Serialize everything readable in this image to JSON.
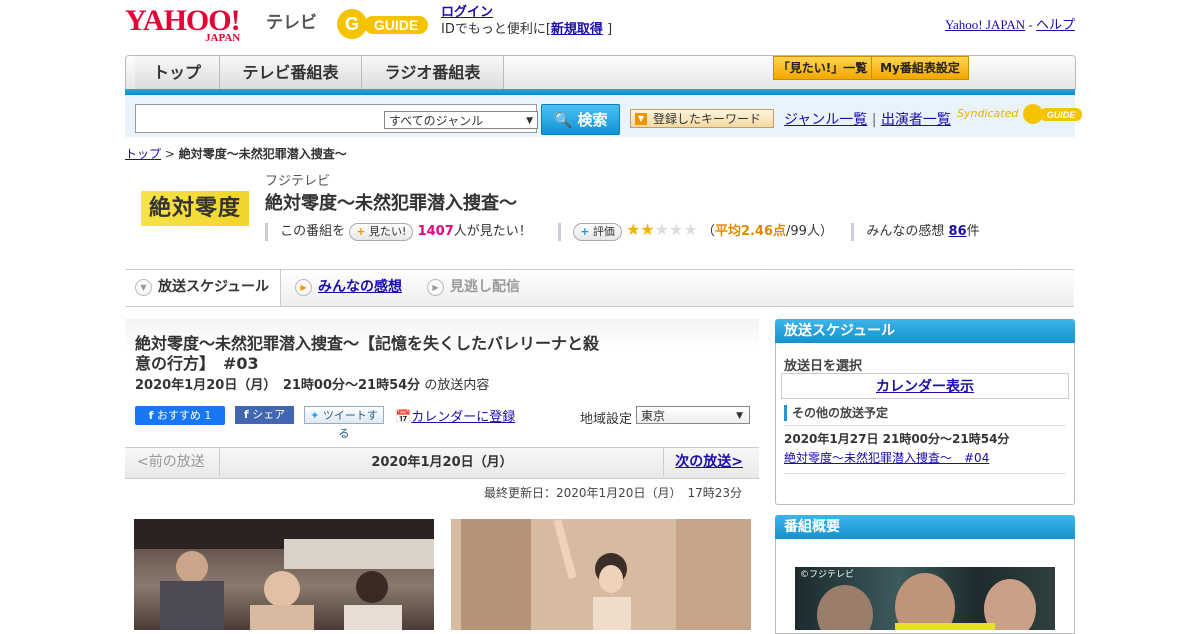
{
  "header": {
    "yahoo_logo": "YAHOO!",
    "yahoo_japan": "JAPAN",
    "tv_label": "テレビ",
    "gguide": "G GUIDE",
    "login": "ログイン",
    "login_sub_prefix": "IDでもっと便利に[",
    "register": "新規取得",
    "login_sub_suffix": "]",
    "yahoo_japan_link": "Yahoo! JAPAN",
    "sep": "-",
    "help": "ヘルプ"
  },
  "nav": {
    "tabs": [
      "トップ",
      "テレビ番組表",
      "ラジオ番組表"
    ],
    "want_list": "「見たい!」一覧",
    "my_schedule": "My番組表設定"
  },
  "search": {
    "genre": "すべてのジャンル",
    "button": "検索",
    "keyword_button": "登録したキーワード",
    "genre_list": "ジャンル一覧",
    "divider": "|",
    "performer_list": "出演者一覧",
    "syndicated": "Syndicated"
  },
  "breadcrumb": {
    "top": "トップ",
    "sep": ">",
    "current": "絶対零度～未然犯罪潜入捜査～"
  },
  "program": {
    "logo_text": "絶対零度",
    "channel": "フジテレビ",
    "title": "絶対零度～未然犯罪潜入捜査～",
    "want_prefix": "この番組を",
    "want_button": "見たい!",
    "want_count": "1407",
    "want_suffix": "人が見たい！",
    "rate_button": "評価",
    "rating_stars": 2.46,
    "avg_prefix": "（",
    "avg_label": "平均2.46点",
    "avg_suffix": "/99人）",
    "impressions_label": "みんなの感想",
    "impressions_count": "86",
    "impressions_unit": "件"
  },
  "tabs": {
    "schedule": "放送スケジュール",
    "impressions": "みんなの感想",
    "streaming": "見逃し配信"
  },
  "episode": {
    "title": "絶対零度～未然犯罪潜入捜査～【記憶を失くしたバレリーナと殺意の行方】　#03",
    "time": "2020年1月20日（月）　21時00分～21時54分",
    "time_suffix": "の放送内容",
    "fb_recommend": "おすすめ 1",
    "fb_share": "シェア",
    "tweet": "ツイートする",
    "calendar_register": "カレンダーに登録",
    "region_label": "地域設定",
    "region": "東京",
    "prev": "<前の放送",
    "date": "2020年1月20日（月）",
    "next": "次の放送>",
    "updated": "最終更新日：2020年1月20日（月）　17時23分"
  },
  "sidebar": {
    "schedule_head": "放送スケジュール",
    "choose_date": "放送日を選択",
    "calendar_show": "カレンダー表示",
    "other_schedule": "その他の放送予定",
    "other_date": "2020年1月27日  21時00分～21時54分",
    "other_link": "絶対零度～未然犯罪潜入捜査～　#04",
    "overview_head": "番組概要",
    "poster_credit": "©フジテレビ"
  },
  "colors": {
    "accent_blue": "#1591ce",
    "brand_red": "#e60033",
    "gold": "#f3a600",
    "pink": "#e4007f"
  }
}
